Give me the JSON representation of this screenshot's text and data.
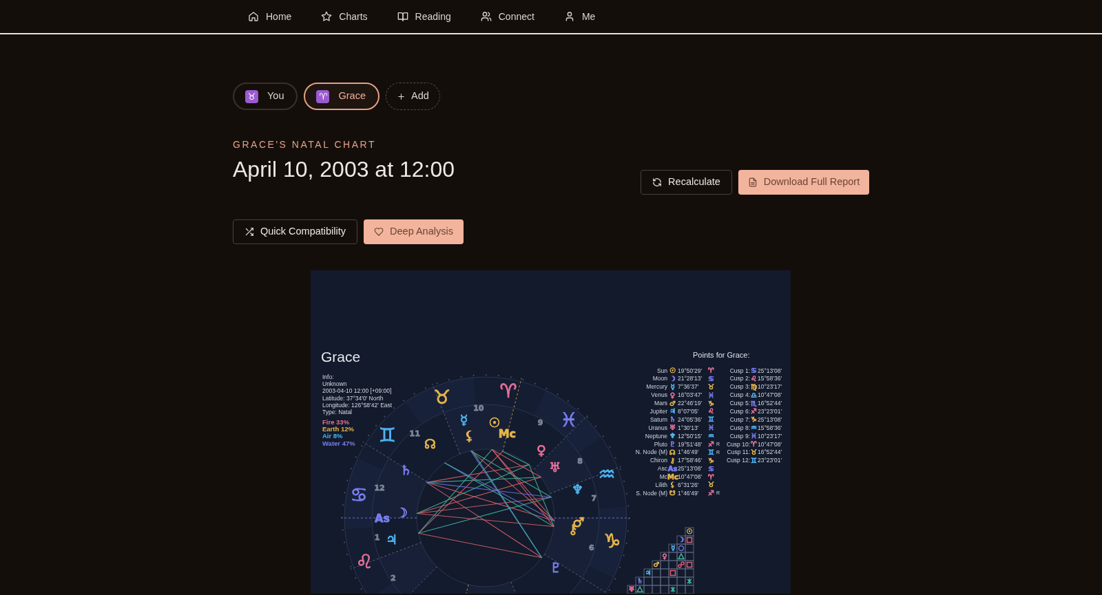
{
  "nav": [
    {
      "label": "Home"
    },
    {
      "label": "Charts"
    },
    {
      "label": "Reading"
    },
    {
      "label": "Connect"
    },
    {
      "label": "Me"
    }
  ],
  "profiles": [
    {
      "icon": "♉",
      "label": "You",
      "selected": false
    },
    {
      "icon": "♈",
      "label": "Grace",
      "selected": true
    }
  ],
  "add_button": "Add",
  "eyebrow": "GRACE'S NATAL CHART",
  "title": "April 10, 2003 at 12:00",
  "header_buttons": [
    "Recalculate",
    "Download Full Report"
  ],
  "action_buttons": [
    "Quick Compatibility",
    "Deep Analysis"
  ],
  "chart": {
    "name": "Grace",
    "info": [
      "Info:",
      "Unknown",
      "2003-04-10 12:00 [+09:00]",
      "Latitude: 37°34'0' North",
      "Longitude: 126°58'42' East",
      "Type: Natal"
    ],
    "elements": [
      {
        "text": "Fire 33%",
        "color": "#e8709a"
      },
      {
        "text": "Earth 12%",
        "color": "#e8b54a"
      },
      {
        "text": "Air 8%",
        "color": "#4fb3f0"
      },
      {
        "text": "Water 47%",
        "color": "#7a7ef0"
      }
    ],
    "points_title": "Points for Grace:",
    "points": [
      {
        "name": "Sun",
        "glyph": {
          "text": "☉",
          "color": "#e8b54a"
        },
        "degree": "19°50'29'",
        "sign": {
          "text": "♈",
          "color": "#e8709a"
        }
      },
      {
        "name": "Moon",
        "glyph": {
          "text": "☽",
          "color": "#7a7ef0"
        },
        "degree": "21°28'13'",
        "sign": {
          "text": "♋",
          "color": "#7a7ef0"
        }
      },
      {
        "name": "Mercury",
        "glyph": {
          "text": "☿",
          "color": "#4fb3f0"
        },
        "degree": "7°36'37'",
        "sign": {
          "text": "♉",
          "color": "#e8b54a"
        }
      },
      {
        "name": "Venus",
        "glyph": {
          "text": "♀",
          "color": "#e8709a"
        },
        "degree": "16°03'47'",
        "sign": {
          "text": "♓",
          "color": "#7a7ef0"
        }
      },
      {
        "name": "Mars",
        "glyph": {
          "text": "♂",
          "color": "#e8b54a"
        },
        "degree": "22°46'19'",
        "sign": {
          "text": "♑",
          "color": "#e8b54a"
        }
      },
      {
        "name": "Jupiter",
        "glyph": {
          "text": "♃",
          "color": "#4fb3f0"
        },
        "degree": "8°07'05'",
        "sign": {
          "text": "♌",
          "color": "#e8709a"
        }
      },
      {
        "name": "Saturn",
        "glyph": {
          "text": "♄",
          "color": "#7a7ef0"
        },
        "degree": "24°05'36'",
        "sign": {
          "text": "♊",
          "color": "#4fb3f0"
        }
      },
      {
        "name": "Uranus",
        "glyph": {
          "text": "♅",
          "color": "#e8709a"
        },
        "degree": "1°30'13'",
        "sign": {
          "text": "♓",
          "color": "#7a7ef0"
        }
      },
      {
        "name": "Neptune",
        "glyph": {
          "text": "♆",
          "color": "#4fb3f0"
        },
        "degree": "12°50'15'",
        "sign": {
          "text": "♒",
          "color": "#4fb3f0"
        }
      },
      {
        "name": "Pluto",
        "glyph": {
          "text": "♇",
          "color": "#7a7ef0"
        },
        "degree": "19°51'48'",
        "sign": {
          "text": "♐",
          "color": "#e8709a"
        },
        "flag": "R"
      },
      {
        "name": "N. Node (M)",
        "glyph": {
          "text": "☊",
          "color": "#e8b54a"
        },
        "degree": "1°46'49'",
        "sign": {
          "text": "♊",
          "color": "#4fb3f0"
        },
        "flag": "R"
      },
      {
        "name": "Chiron",
        "glyph": {
          "text": "⚷",
          "color": "#e8b54a"
        },
        "degree": "17°58'46'",
        "sign": {
          "text": "♑",
          "color": "#e8b54a"
        }
      },
      {
        "name": "Asc",
        "glyph": {
          "text": "As",
          "color": "#7a7ef0"
        },
        "degree": "25°13'08'",
        "sign": {
          "text": "♋",
          "color": "#7a7ef0"
        }
      },
      {
        "name": "Mc",
        "glyph": {
          "text": "Mc",
          "color": "#e8b54a"
        },
        "degree": "10°47'08'",
        "sign": {
          "text": "♈",
          "color": "#e8709a"
        }
      },
      {
        "name": "Lilith",
        "glyph": {
          "text": "⚸",
          "color": "#e8b54a"
        },
        "degree": "6°31'26'",
        "sign": {
          "text": "♉",
          "color": "#e8b54a"
        }
      },
      {
        "name": "S. Node (M)",
        "glyph": {
          "text": "☋",
          "color": "#e8b54a"
        },
        "degree": "1°46'49'",
        "sign": {
          "text": "♐",
          "color": "#e8709a"
        },
        "flag": "R"
      }
    ],
    "cusps": [
      {
        "label": "Cusp 1:",
        "sign": {
          "text": "♋",
          "color": "#7a7ef0"
        },
        "degree": "25°13'08'"
      },
      {
        "label": "Cusp 2:",
        "sign": {
          "text": "♌",
          "color": "#e8709a"
        },
        "degree": "15°58'36'"
      },
      {
        "label": "Cusp 3:",
        "sign": {
          "text": "♍",
          "color": "#e8b54a"
        },
        "degree": "10°23'17'"
      },
      {
        "label": "Cusp 4:",
        "sign": {
          "text": "♎",
          "color": "#4fb3f0"
        },
        "degree": "10°47'08'"
      },
      {
        "label": "Cusp 5:",
        "sign": {
          "text": "♏",
          "color": "#7a7ef0"
        },
        "degree": "16°52'44'"
      },
      {
        "label": "Cusp 6:",
        "sign": {
          "text": "♐",
          "color": "#e8709a"
        },
        "degree": "23°23'01'"
      },
      {
        "label": "Cusp 7:",
        "sign": {
          "text": "♑",
          "color": "#e8b54a"
        },
        "degree": "25°13'08'"
      },
      {
        "label": "Cusp 8:",
        "sign": {
          "text": "♒",
          "color": "#4fb3f0"
        },
        "degree": "15°58'36'"
      },
      {
        "label": "Cusp 9:",
        "sign": {
          "text": "♓",
          "color": "#7a7ef0"
        },
        "degree": "10°23'17'"
      },
      {
        "label": "Cusp 10:",
        "sign": {
          "text": "♈",
          "color": "#e8709a"
        },
        "degree": "10°47'08'"
      },
      {
        "label": "Cusp 11:",
        "sign": {
          "text": "♉",
          "color": "#e8b54a"
        },
        "degree": "16°52'44'"
      },
      {
        "label": "Cusp 12:",
        "sign": {
          "text": "♊",
          "color": "#4fb3f0"
        },
        "degree": "23°23'01'"
      }
    ],
    "wheel": {
      "signs": [
        {
          "glyph": "♈",
          "color": "#e8709a"
        },
        {
          "glyph": "♉",
          "color": "#e8b54a"
        },
        {
          "glyph": "♊",
          "color": "#4fb3f0"
        },
        {
          "glyph": "♋",
          "color": "#7a7ef0"
        },
        {
          "glyph": "♌",
          "color": "#e8709a"
        },
        {
          "glyph": "♑",
          "color": "#e8b54a"
        },
        {
          "glyph": "♒",
          "color": "#4fb3f0"
        },
        {
          "glyph": "♓",
          "color": "#7a7ef0"
        }
      ],
      "house_numbers": [
        "1",
        "2",
        "6",
        "7",
        "8",
        "9",
        "10",
        "11",
        "12"
      ],
      "planets": [
        {
          "glyph": "☉",
          "color": "#e8b54a"
        },
        {
          "glyph": "☽",
          "color": "#7a7ef0"
        },
        {
          "glyph": "☿",
          "color": "#4fb3f0"
        },
        {
          "glyph": "♀",
          "color": "#e8709a"
        },
        {
          "glyph": "♂",
          "color": "#e8b54a"
        },
        {
          "glyph": "♃",
          "color": "#4fb3f0"
        },
        {
          "glyph": "♄",
          "color": "#7a7ef0"
        },
        {
          "glyph": "♅",
          "color": "#e8709a"
        },
        {
          "glyph": "♆",
          "color": "#4fb3f0"
        },
        {
          "glyph": "♇",
          "color": "#7a7ef0"
        },
        {
          "glyph": "☊",
          "color": "#e8b54a"
        },
        {
          "glyph": "⚷",
          "color": "#e8b54a"
        },
        {
          "glyph": "As",
          "color": "#7a7ef0"
        },
        {
          "glyph": "Mc",
          "color": "#e8b54a"
        },
        {
          "glyph": "⚸",
          "color": "#e8b54a"
        }
      ]
    },
    "aspect_grid": [
      {
        "glyph": "☉",
        "color": "#e8b54a"
      },
      {
        "glyph": "☽",
        "color": "#7a7ef0"
      },
      {
        "glyph": "☿",
        "color": "#4fb3f0"
      },
      {
        "glyph": "♀",
        "color": "#e8709a"
      },
      {
        "glyph": "♂",
        "color": "#e8b54a"
      },
      {
        "glyph": "♃",
        "color": "#4fb3f0"
      },
      {
        "glyph": "♄",
        "color": "#7a7ef0"
      },
      {
        "glyph": "♅",
        "color": "#e8709a"
      }
    ]
  }
}
